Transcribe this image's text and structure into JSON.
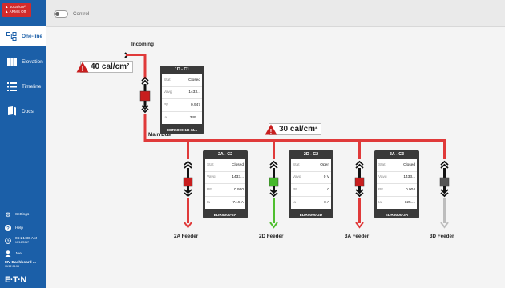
{
  "alert": {
    "line1": "40cal/cm²",
    "line2": "ARMS Off"
  },
  "sidebar": {
    "items": [
      {
        "label": "One-line",
        "icon": "one-line-icon"
      },
      {
        "label": "Elevation",
        "icon": "elevation-icon"
      },
      {
        "label": "Timeline",
        "icon": "timeline-icon"
      },
      {
        "label": "Docs",
        "icon": "docs-icon"
      }
    ],
    "bottom": {
      "settings": "Settings",
      "help": "Help",
      "time": "06:21:36 AM",
      "date": "10/16/2017",
      "user": "Joel",
      "dashboard": "MV Dashboard ...",
      "dashboard_sub": "10/12 06:54",
      "logo": "E·T·N"
    }
  },
  "topbar": {
    "control_label": "Control",
    "control_on": false
  },
  "diagram": {
    "incoming_label": "Incoming",
    "mainbus_label": "Main Bus",
    "flash_main": "40 cal/cm²",
    "flash_bus": "30 cal/cm²",
    "breakers": [
      {
        "title": "1D - C1",
        "stat": "Closed",
        "vavg": "1433...",
        "pf": "0.947",
        "ia": "349....",
        "device": "EDR5000-1D-M..."
      },
      {
        "title": "2A - C2",
        "stat": "Closed",
        "vavg": "1433...",
        "pf": "0.920",
        "ia": "74.5 A",
        "device": "EDR5000-2A"
      },
      {
        "title": "2D - C2",
        "stat": "Open",
        "vavg": "0 V",
        "pf": "0",
        "ia": "0 A",
        "device": "EDR5000-2D"
      },
      {
        "title": "3A - C3",
        "stat": "Closed",
        "vavg": "1433...",
        "pf": "0.904",
        "ia": "125....",
        "device": "EDR5000-3A"
      }
    ],
    "row_keys": {
      "stat": "Stat",
      "vavg": "Vavg",
      "pf": "PF",
      "ia": "Ia"
    },
    "feeders": [
      "2A Feeder",
      "2D Feeder",
      "3A Feeder",
      "3D Feeder"
    ],
    "colors": {
      "energized": "#e03a3a",
      "open": "#4fbf2f",
      "deenergized": "#bdbdbd",
      "closed_breaker": "#c81e1e",
      "open_breaker": "#46b82b",
      "unknown_breaker": "#555555"
    }
  }
}
